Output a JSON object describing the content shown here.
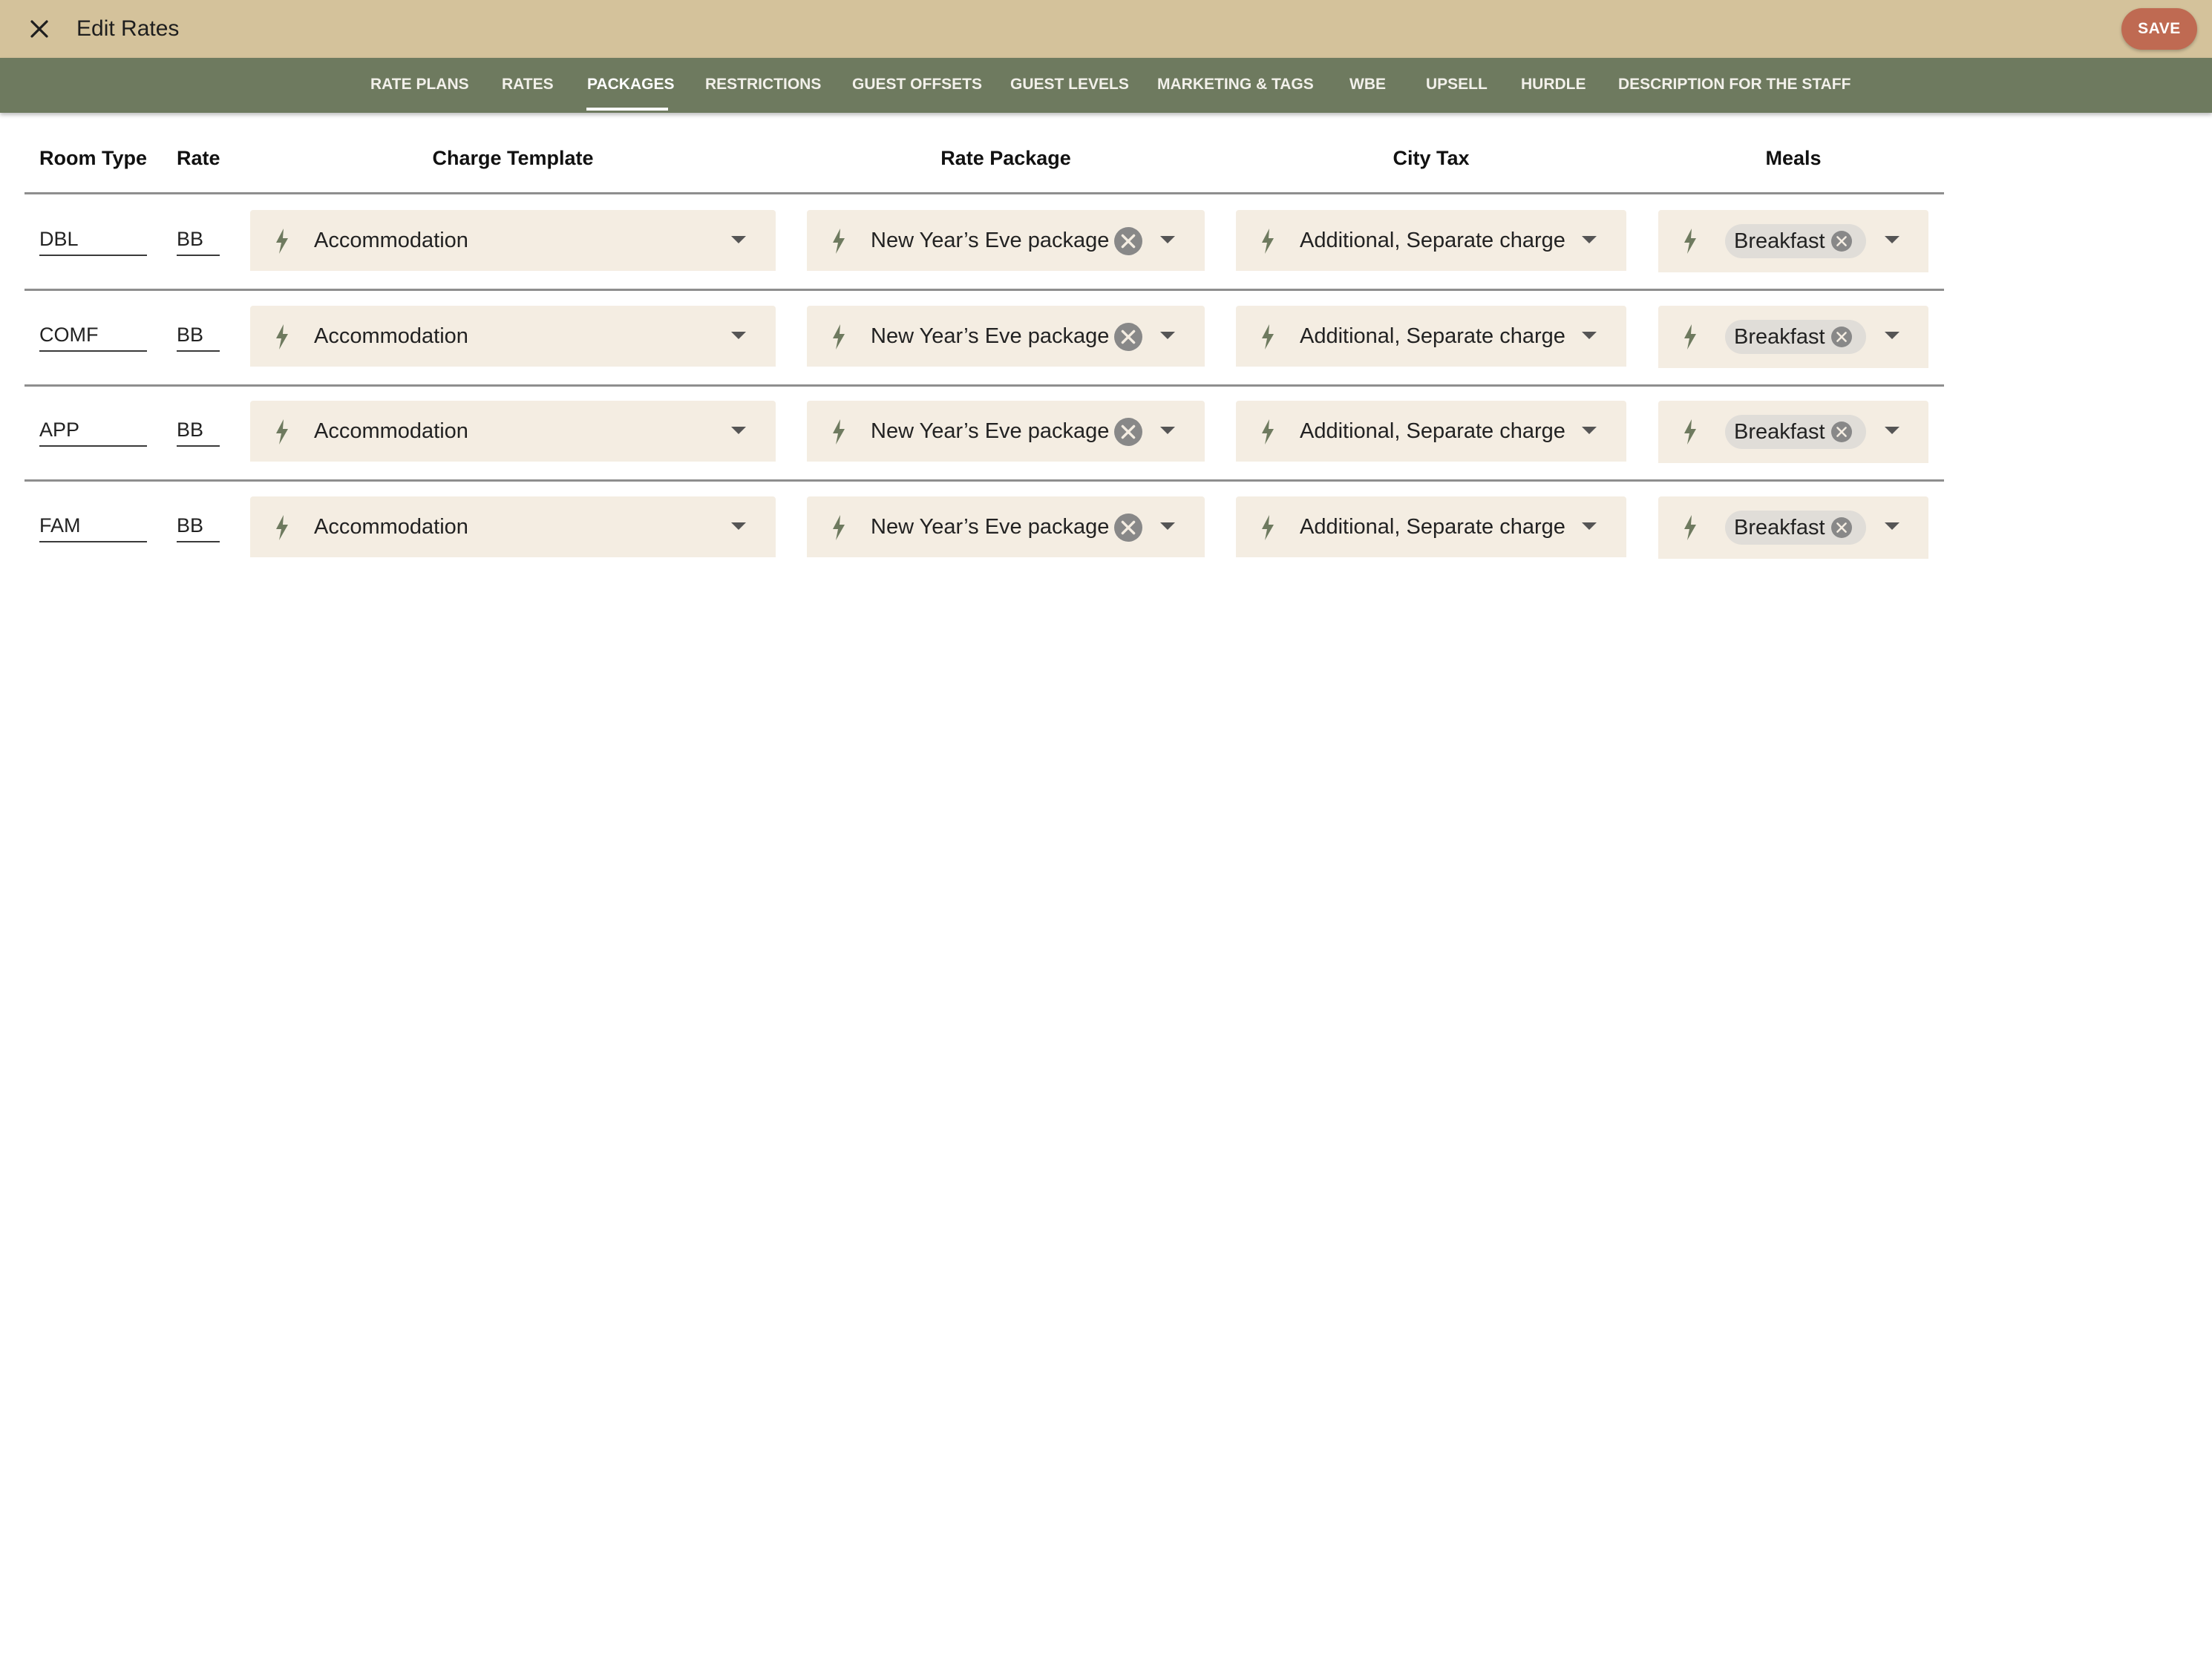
{
  "header": {
    "title": "Edit Rates",
    "save_label": "SAVE",
    "close_icon": "close-icon"
  },
  "tabs": [
    {
      "label": "RATE PLANS",
      "active": false
    },
    {
      "label": "RATES",
      "active": false
    },
    {
      "label": "PACKAGES",
      "active": true
    },
    {
      "label": "RESTRICTIONS",
      "active": false
    },
    {
      "label": "GUEST OFFSETS",
      "active": false
    },
    {
      "label": "GUEST LEVELS",
      "active": false
    },
    {
      "label": "MARKETING & TAGS",
      "active": false
    },
    {
      "label": "WBE",
      "active": false
    },
    {
      "label": "UPSELL",
      "active": false
    },
    {
      "label": "HURDLE",
      "active": false
    },
    {
      "label": "DESCRIPTION FOR THE STAFF",
      "active": false
    }
  ],
  "table": {
    "headers": {
      "room_type": "Room Type",
      "rate": "Rate",
      "charge_template": "Charge Template",
      "rate_package": "Rate Package",
      "city_tax": "City Tax",
      "meals": "Meals"
    },
    "rows": [
      {
        "room_type": "DBL",
        "rate": "BB",
        "charge_template": "Accommodation",
        "rate_package": "New Year’s Eve package",
        "city_tax": "Additional, Separate charge",
        "meals": "Breakfast"
      },
      {
        "room_type": "COMF",
        "rate": "BB",
        "charge_template": "Accommodation",
        "rate_package": "New Year’s Eve package",
        "city_tax": "Additional, Separate charge",
        "meals": "Breakfast"
      },
      {
        "room_type": "APP",
        "rate": "BB",
        "charge_template": "Accommodation",
        "rate_package": "New Year’s Eve package",
        "city_tax": "Additional, Separate charge",
        "meals": "Breakfast"
      },
      {
        "room_type": "FAM",
        "rate": "BB",
        "charge_template": "Accommodation",
        "rate_package": "New Year’s Eve package",
        "city_tax": "Additional, Separate charge",
        "meals": "Breakfast"
      }
    ]
  },
  "colors": {
    "topbar": "#d4c29b",
    "tabbar": "#6e7a5f",
    "save_button": "#bf6a52",
    "select_background": "#f4ede2",
    "icon": "#6e7a5f"
  },
  "icons": {
    "select_icon": "lightning-bolt-icon",
    "clear_icon": "clear-circle-icon",
    "dropdown_icon": "chevron-down-icon"
  }
}
